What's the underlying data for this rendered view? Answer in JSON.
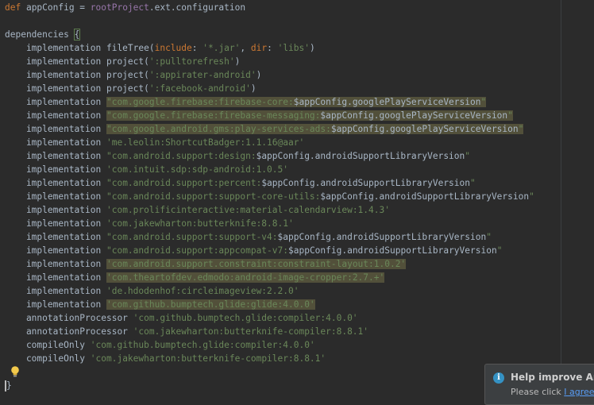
{
  "code_lines": [
    [
      {
        "t": "def ",
        "c": "kw"
      },
      {
        "t": "appConfig = "
      },
      {
        "t": "rootProject",
        "c": "root"
      },
      {
        "t": ".ext.configuration"
      }
    ],
    [],
    [
      {
        "t": "dependencies "
      },
      {
        "t": "{",
        "c": "bracehl"
      }
    ],
    [
      {
        "t": "    implementation fileTree("
      },
      {
        "t": "include",
        "c": "kw"
      },
      {
        "t": ": "
      },
      {
        "t": "'*.jar'",
        "c": "str"
      },
      {
        "t": ", "
      },
      {
        "t": "dir",
        "c": "kw"
      },
      {
        "t": ": "
      },
      {
        "t": "'libs'",
        "c": "str"
      },
      {
        "t": ")"
      }
    ],
    [
      {
        "t": "    implementation project("
      },
      {
        "t": "':pulltorefresh'",
        "c": "str"
      },
      {
        "t": ")"
      }
    ],
    [
      {
        "t": "    implementation project("
      },
      {
        "t": "':appirater-android'",
        "c": "str"
      },
      {
        "t": ")"
      }
    ],
    [
      {
        "t": "    implementation project("
      },
      {
        "t": "':facebook-android'",
        "c": "str"
      },
      {
        "t": ")"
      }
    ],
    [
      {
        "t": "    implementation "
      },
      {
        "t": "\"com.google.firebase:firebase-core:",
        "c": "str hl"
      },
      {
        "t": "$appConfig.googlePlayServiceVersion",
        "c": "hl"
      },
      {
        "t": "\"",
        "c": "str hl"
      }
    ],
    [
      {
        "t": "    implementation "
      },
      {
        "t": "\"com.google.firebase:firebase-messaging:",
        "c": "str hl"
      },
      {
        "t": "$appConfig.googlePlayServiceVersion",
        "c": "hl"
      },
      {
        "t": "\"",
        "c": "str hl"
      }
    ],
    [
      {
        "t": "    implementation "
      },
      {
        "t": "\"com.google.android.gms:play-services-ads:",
        "c": "str hl"
      },
      {
        "t": "$appConfig.googlePlayServiceVersion",
        "c": "hl"
      },
      {
        "t": "\"",
        "c": "str hl"
      }
    ],
    [
      {
        "t": "    implementation "
      },
      {
        "t": "'me.leolin:ShortcutBadger:1.1.16@aar'",
        "c": "str"
      }
    ],
    [
      {
        "t": "    implementation "
      },
      {
        "t": "\"com.android.support:design:",
        "c": "str"
      },
      {
        "t": "$appConfig.androidSupportLibraryVersion"
      },
      {
        "t": "\"",
        "c": "str"
      }
    ],
    [
      {
        "t": "    implementation "
      },
      {
        "t": "'com.intuit.sdp:sdp-android:1.0.5'",
        "c": "str"
      }
    ],
    [
      {
        "t": "    implementation "
      },
      {
        "t": "\"com.android.support:percent:",
        "c": "str"
      },
      {
        "t": "$appConfig.androidSupportLibraryVersion"
      },
      {
        "t": "\"",
        "c": "str"
      }
    ],
    [
      {
        "t": "    implementation "
      },
      {
        "t": "\"com.android.support:support-core-utils:",
        "c": "str"
      },
      {
        "t": "$appConfig.androidSupportLibraryVersion"
      },
      {
        "t": "\"",
        "c": "str"
      }
    ],
    [
      {
        "t": "    implementation "
      },
      {
        "t": "'com.prolificinteractive:material-calendarview:1.4.3'",
        "c": "str"
      }
    ],
    [
      {
        "t": "    implementation "
      },
      {
        "t": "'com.jakewharton:butterknife:8.8.1'",
        "c": "str"
      }
    ],
    [
      {
        "t": "    implementation "
      },
      {
        "t": "\"com.android.support:support-v4:",
        "c": "str"
      },
      {
        "t": "$appConfig.androidSupportLibraryVersion"
      },
      {
        "t": "\"",
        "c": "str"
      }
    ],
    [
      {
        "t": "    implementation "
      },
      {
        "t": "\"com.android.support:appcompat-v7:",
        "c": "str"
      },
      {
        "t": "$appConfig.androidSupportLibraryVersion"
      },
      {
        "t": "\"",
        "c": "str"
      }
    ],
    [
      {
        "t": "    implementation "
      },
      {
        "t": "'com.android.support.constraint:constraint-layout:1.0.2'",
        "c": "str hl"
      }
    ],
    [
      {
        "t": "    implementation "
      },
      {
        "t": "'com.theartofdev.edmodo:android-image-cropper:2.7.+'",
        "c": "str hl"
      }
    ],
    [
      {
        "t": "    implementation "
      },
      {
        "t": "'de.hdodenhof:circleimageview:2.2.0'",
        "c": "str"
      }
    ],
    [
      {
        "t": "    implementation "
      },
      {
        "t": "'com.github.bumptech.glide:glide:4.0.0'",
        "c": "str hl"
      }
    ],
    [
      {
        "t": "    annotationProcessor "
      },
      {
        "t": "'com.github.bumptech.glide:compiler:4.0.0'",
        "c": "str"
      }
    ],
    [
      {
        "t": "    annotationProcessor "
      },
      {
        "t": "'com.jakewharton:butterknife-compiler:8.8.1'",
        "c": "str"
      }
    ],
    [
      {
        "t": "    compileOnly "
      },
      {
        "t": "'com.github.bumptech.glide:compiler:4.0.0'",
        "c": "str"
      }
    ],
    [
      {
        "t": "    compileOnly "
      },
      {
        "t": "'com.jakewharton:butterknife-compiler:8.8.1'",
        "c": "str"
      }
    ],
    [],
    [
      {
        "t": "caret",
        "c": "caret"
      },
      {
        "t": "}"
      }
    ]
  ],
  "notification": {
    "title": "Help improve Andr",
    "body_prefix": "Please click ",
    "link": "I agree i"
  },
  "icons": {
    "bulb": "lightbulb-icon",
    "info": "info-icon"
  }
}
